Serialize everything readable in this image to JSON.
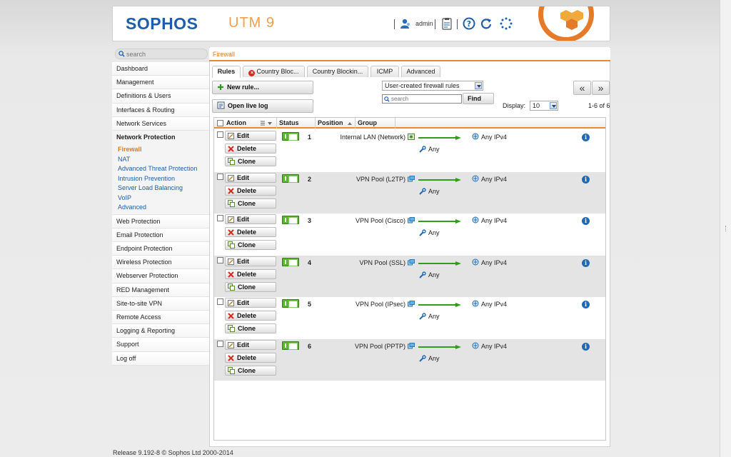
{
  "header": {
    "logo": "SOPHOS",
    "product": "UTM 9",
    "user": "admin"
  },
  "search": {
    "placeholder": "search"
  },
  "breadcrumb": "Firewall",
  "sidebar": {
    "items_top": [
      "Dashboard",
      "Management",
      "Definitions & Users",
      "Interfaces & Routing",
      "Network Services"
    ],
    "active": "Network Protection",
    "sub_items": [
      "Firewall",
      "NAT",
      "Advanced Threat Protection",
      "Intrusion Prevention",
      "Server Load Balancing",
      "VoIP",
      "Advanced"
    ],
    "items_bottom": [
      "Web Protection",
      "Email Protection",
      "Endpoint Protection",
      "Wireless Protection",
      "Webserver Protection",
      "RED Management",
      "Site-to-site VPN",
      "Remote Access",
      "Logging & Reporting",
      "Support",
      "Log off"
    ]
  },
  "tabs": [
    "Rules",
    "Country Bloc...",
    "Country Blockin...",
    "ICMP",
    "Advanced"
  ],
  "toolbar": {
    "new_rule": "New rule...",
    "open_live_log": "Open live log",
    "filter_select": "User-created firewall rules",
    "filter_search_placeholder": "search",
    "find": "Find",
    "display_label": "Display:",
    "display_value": "10",
    "range": "1-6 of 6",
    "prev": "«",
    "next": "»"
  },
  "table": {
    "columns": [
      "Action",
      "Status",
      "Position",
      "Group"
    ],
    "buttons": {
      "edit": "Edit",
      "delete": "Delete",
      "clone": "Clone"
    },
    "rows": [
      {
        "position": "1",
        "source": "Internal LAN (Network)",
        "service": "Any",
        "destination": "Any IPv4",
        "info": "i"
      },
      {
        "position": "2",
        "source": "VPN Pool (L2TP)",
        "service": "Any",
        "destination": "Any IPv4",
        "info": "i"
      },
      {
        "position": "3",
        "source": "VPN Pool (Cisco)",
        "service": "Any",
        "destination": "Any IPv4",
        "info": "i"
      },
      {
        "position": "4",
        "source": "VPN Pool (SSL)",
        "service": "Any",
        "destination": "Any IPv4",
        "info": "i"
      },
      {
        "position": "5",
        "source": "VPN Pool (IPsec)",
        "service": "Any",
        "destination": "Any IPv4",
        "info": "i"
      },
      {
        "position": "6",
        "source": "VPN Pool (PPTP)",
        "service": "Any",
        "destination": "Any IPv4",
        "info": "i"
      }
    ]
  },
  "footer": "Release 9.192-8 © Sophos Ltd 2000-2014",
  "colors": {
    "brand_blue": "#1e5ea8",
    "accent_orange": "#e88a30",
    "status_green": "#56b82a",
    "info_blue": "#2169b3"
  }
}
